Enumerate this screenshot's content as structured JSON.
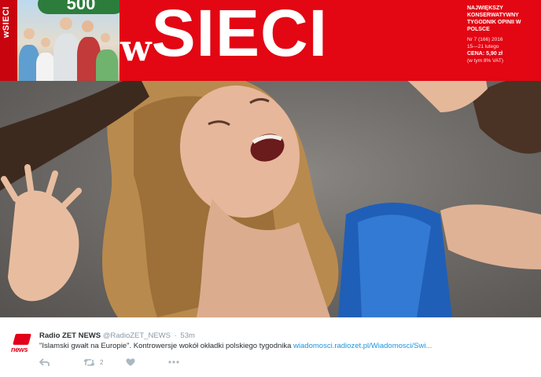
{
  "cover": {
    "side_strip_text": "wSIECI",
    "badge_text": "500",
    "masthead_prefix": "w",
    "masthead_main": "SIECI",
    "tagline": "Największy konserwatywny tygodnik opinii w Polsce",
    "issue": "Nr 7 (166) 2016",
    "dates": "15—21 lutego",
    "price": "CENA: 5,90 zł",
    "vat": "(w tym 8% VAT)",
    "colors": {
      "brand_red": "#e30613",
      "masthead_white": "#ffffff"
    }
  },
  "tweet": {
    "author_name": "Radio ZET NEWS",
    "handle": "@RadioZET_NEWS",
    "separator": "·",
    "time": "53m",
    "avatar_logo_text": "news",
    "text": "\"Islamski gwałt na Europie\". Kontrowersje wokół okładki polskiego tygodnika ",
    "link": "wiadomosci.radiozet.pl/Wiadomosci/Swi...",
    "retweet_count": "2",
    "icons": [
      "reply-icon",
      "retweet-icon",
      "like-icon",
      "more-icon"
    ],
    "colors": {
      "link": "#1b95e0",
      "text": "#292f33",
      "meta": "#8899a6",
      "icon": "#aab8c2"
    }
  }
}
